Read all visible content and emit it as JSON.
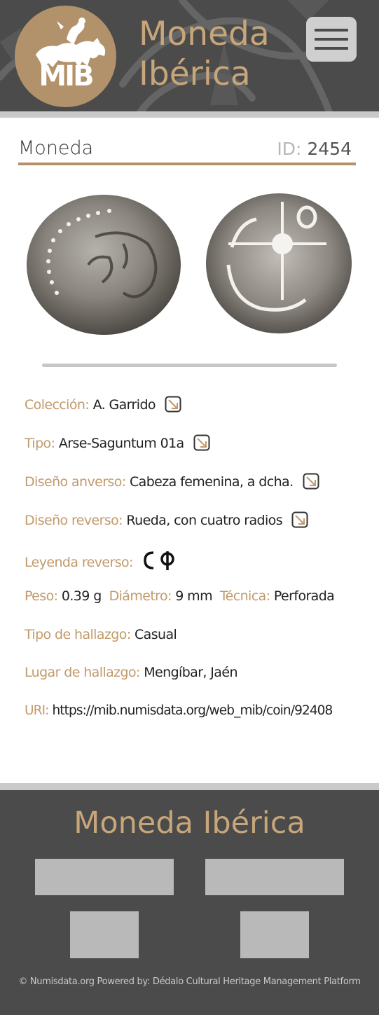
{
  "site": {
    "title": "Moneda Ibérica",
    "title_line1": "Moneda",
    "title_line2": "Ibérica",
    "logo_text": "MIB"
  },
  "coin": {
    "heading": "Moneda",
    "id_label": "ID:",
    "id_value": "2454",
    "obverse_alt": "Cabeza femenina, a dcha.",
    "reverse_alt": "Rueda, con cuatro radios"
  },
  "details": {
    "coleccion": {
      "label": "Colección:",
      "value": "A. Garrido"
    },
    "tipo": {
      "label": "Tipo:",
      "value": "Arse-Saguntum 01a"
    },
    "diseno_anverso": {
      "label": "Diseño anverso:",
      "value": "Cabeza femenina, a dcha."
    },
    "diseno_reverso": {
      "label": "Diseño reverso:",
      "value": "Rueda, con cuatro radios"
    },
    "leyenda_reverso": {
      "label": "Leyenda reverso:"
    },
    "peso": {
      "label": "Peso:",
      "value": "0.39 g"
    },
    "diametro": {
      "label": "Diámetro:",
      "value": "9 mm"
    },
    "tecnica": {
      "label": "Técnica:",
      "value": "Perforada"
    },
    "tipo_hallazgo": {
      "label": "Tipo de hallazgo:",
      "value": "Casual"
    },
    "lugar_hallazgo": {
      "label": "Lugar de hallazgo:",
      "value": "Mengíbar, Jaén"
    },
    "uri": {
      "label": "URI:",
      "value": "https://mib.numisdata.org/web_mib/coin/92408"
    }
  },
  "footer": {
    "title": "Moneda Ibérica",
    "copyright": "© Numisdata.org Powered by: Dédalo Cultural Heritage Management Platform"
  },
  "colors": {
    "accent": "#b2926a",
    "header_bg": "#4b4b4b",
    "label": "#c19a6b",
    "title": "#c7a67a"
  },
  "icons": {
    "menu": "hamburger-menu-icon",
    "link": "external-link-icon",
    "legend": "iberian-legend-glyphs-icon"
  }
}
